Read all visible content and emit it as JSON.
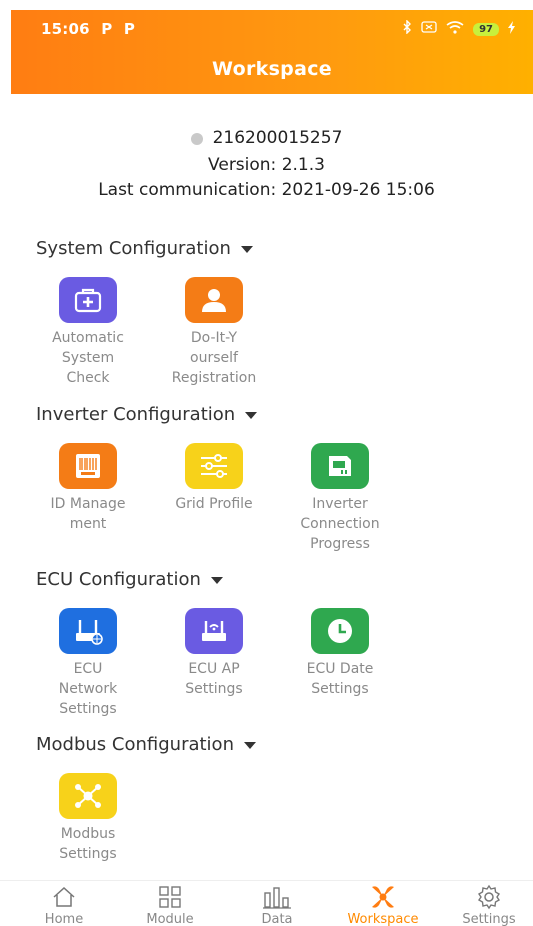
{
  "status_bar": {
    "time": "15:06",
    "p1": "P",
    "p2": "P",
    "battery": "97"
  },
  "header": {
    "title": "Workspace"
  },
  "device": {
    "serial": "216200015257",
    "version": "Version: 2.1.3",
    "last_communication": "Last communication: 2021-09-26 15:06"
  },
  "sections": [
    {
      "title": "System Configuration",
      "items": [
        {
          "label": "Automatic\nSystem\nCheck",
          "icon": "medical-kit-icon",
          "color": "#6a5be2"
        },
        {
          "label": "Do-It-Y\nourself\nRegistration",
          "icon": "user-icon",
          "color": "#f47c16"
        }
      ]
    },
    {
      "title": "Inverter Configuration",
      "items": [
        {
          "label": "ID Manage\nment",
          "icon": "barcode-icon",
          "color": "#f47c16"
        },
        {
          "label": "Grid Profile",
          "icon": "sliders-icon",
          "color": "#f7d21a"
        },
        {
          "label": "Inverter\nConnection\nProgress",
          "icon": "inverter-icon",
          "color": "#2fa84f"
        }
      ]
    },
    {
      "title": "ECU Configuration",
      "items": [
        {
          "label": "ECU\nNetwork\nSettings",
          "icon": "ecu-network-icon",
          "color": "#1f6fe0"
        },
        {
          "label": "ECU AP\nSettings",
          "icon": "ecu-ap-icon",
          "color": "#6a5be2"
        },
        {
          "label": "ECU Date\nSettings",
          "icon": "clock-icon",
          "color": "#2fa84f"
        }
      ]
    },
    {
      "title": "Modbus Configuration",
      "items": [
        {
          "label": "Modbus\nSettings",
          "icon": "network-nodes-icon",
          "color": "#f7d21a"
        }
      ]
    }
  ],
  "tabs": [
    {
      "label": "Home",
      "icon": "home-icon"
    },
    {
      "label": "Module",
      "icon": "grid-icon"
    },
    {
      "label": "Data",
      "icon": "bar-chart-icon"
    },
    {
      "label": "Workspace",
      "icon": "workspace-icon",
      "active": true
    },
    {
      "label": "Settings",
      "icon": "gear-icon"
    }
  ]
}
